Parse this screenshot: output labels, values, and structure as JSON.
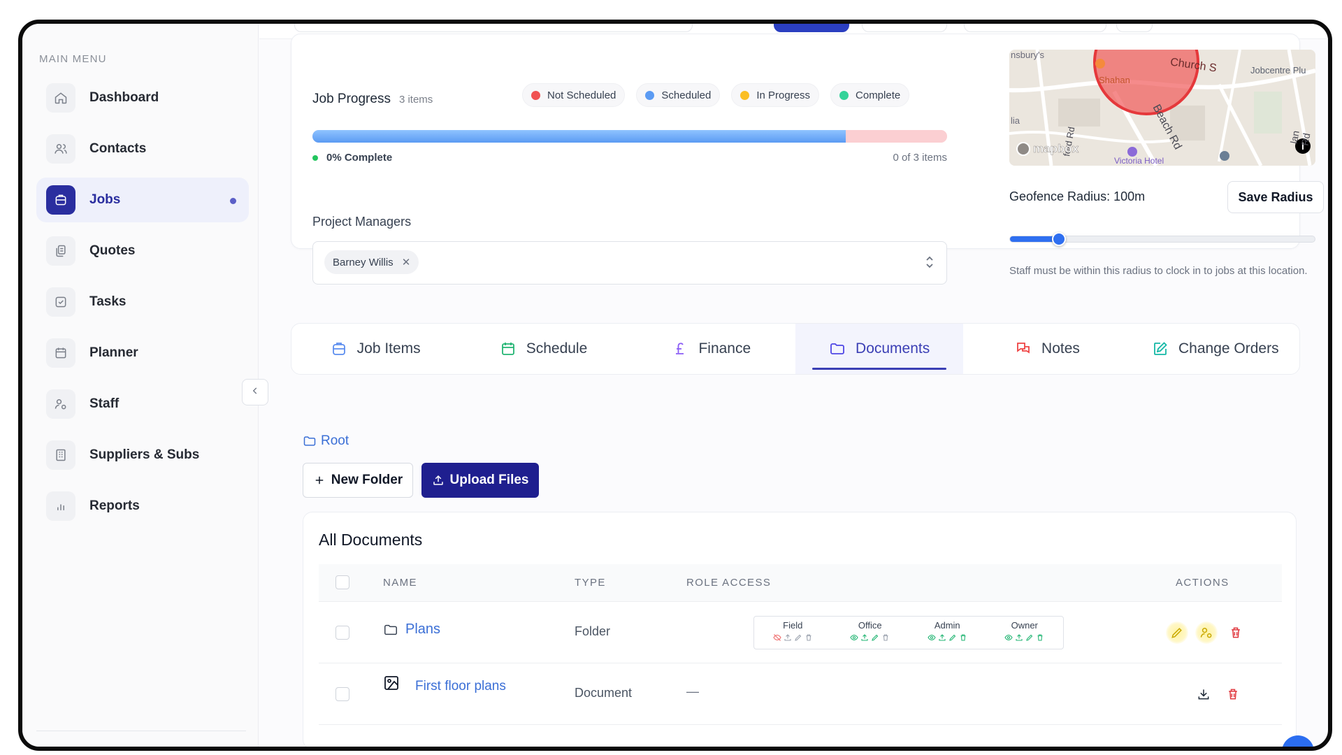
{
  "sidebar": {
    "heading": "MAIN MENU",
    "items": [
      {
        "label": "Dashboard",
        "icon": "home-icon"
      },
      {
        "label": "Contacts",
        "icon": "users-icon"
      },
      {
        "label": "Jobs",
        "icon": "briefcase-icon",
        "active": true
      },
      {
        "label": "Quotes",
        "icon": "documents-icon"
      },
      {
        "label": "Tasks",
        "icon": "checkbox-icon"
      },
      {
        "label": "Planner",
        "icon": "calendar-icon"
      },
      {
        "label": "Staff",
        "icon": "user-settings-icon"
      },
      {
        "label": "Suppliers & Subs",
        "icon": "building-icon"
      },
      {
        "label": "Reports",
        "icon": "bar-chart-icon"
      }
    ]
  },
  "job_progress": {
    "title": "Job Progress",
    "count": "3 items",
    "legend": [
      {
        "label": "Not Scheduled",
        "color": "#f05252"
      },
      {
        "label": "Scheduled",
        "color": "#5b9bf3"
      },
      {
        "label": "In Progress",
        "color": "#fbbf24"
      },
      {
        "label": "Complete",
        "color": "#34d399"
      }
    ],
    "bar": {
      "scheduled_fraction": 0.84,
      "not_scheduled_fraction": 0.16
    },
    "percent_label": "0% Complete",
    "items_label": "0 of 3 items"
  },
  "project_managers": {
    "label": "Project Managers",
    "selected": [
      "Barney Willis"
    ]
  },
  "map": {
    "labels": [
      "nsbury's",
      "Church S",
      "Jobcentre Plu",
      "Shahan",
      "Beach Rd",
      "ford Rd",
      "lan Rd",
      "Victoria Hotel",
      "mapbox",
      "lia"
    ]
  },
  "geofence": {
    "label": "Geofence Radius: 100m",
    "save_label": "Save Radius",
    "slider_fraction": 0.16,
    "help": "Staff must be within this radius to clock in to jobs at this location."
  },
  "tabs": [
    {
      "label": "Job Items",
      "icon": "briefcase-icon",
      "color": "#5b8def"
    },
    {
      "label": "Schedule",
      "icon": "calendar-icon",
      "color": "#22b573"
    },
    {
      "label": "Finance",
      "icon": "pound-icon",
      "color": "#8b5cf6"
    },
    {
      "label": "Documents",
      "icon": "folder-icon",
      "color": "#4f46e5",
      "active": true
    },
    {
      "label": "Notes",
      "icon": "chat-icon",
      "color": "#ef4444"
    },
    {
      "label": "Change Orders",
      "icon": "edit-square-icon",
      "color": "#14b8a6"
    }
  ],
  "documents": {
    "breadcrumb": "Root",
    "new_folder_label": "New Folder",
    "upload_label": "Upload Files",
    "title": "All Documents",
    "columns": {
      "name": "NAME",
      "type": "TYPE",
      "role_access": "ROLE ACCESS",
      "actions": "ACTIONS"
    },
    "roles": [
      "Field",
      "Office",
      "Admin",
      "Owner"
    ],
    "rows": [
      {
        "name": "Plans",
        "type": "Folder",
        "icon": "folder-icon"
      },
      {
        "name": "First floor plans",
        "type": "Document",
        "icon": "image-icon",
        "role_access": "—"
      }
    ]
  }
}
